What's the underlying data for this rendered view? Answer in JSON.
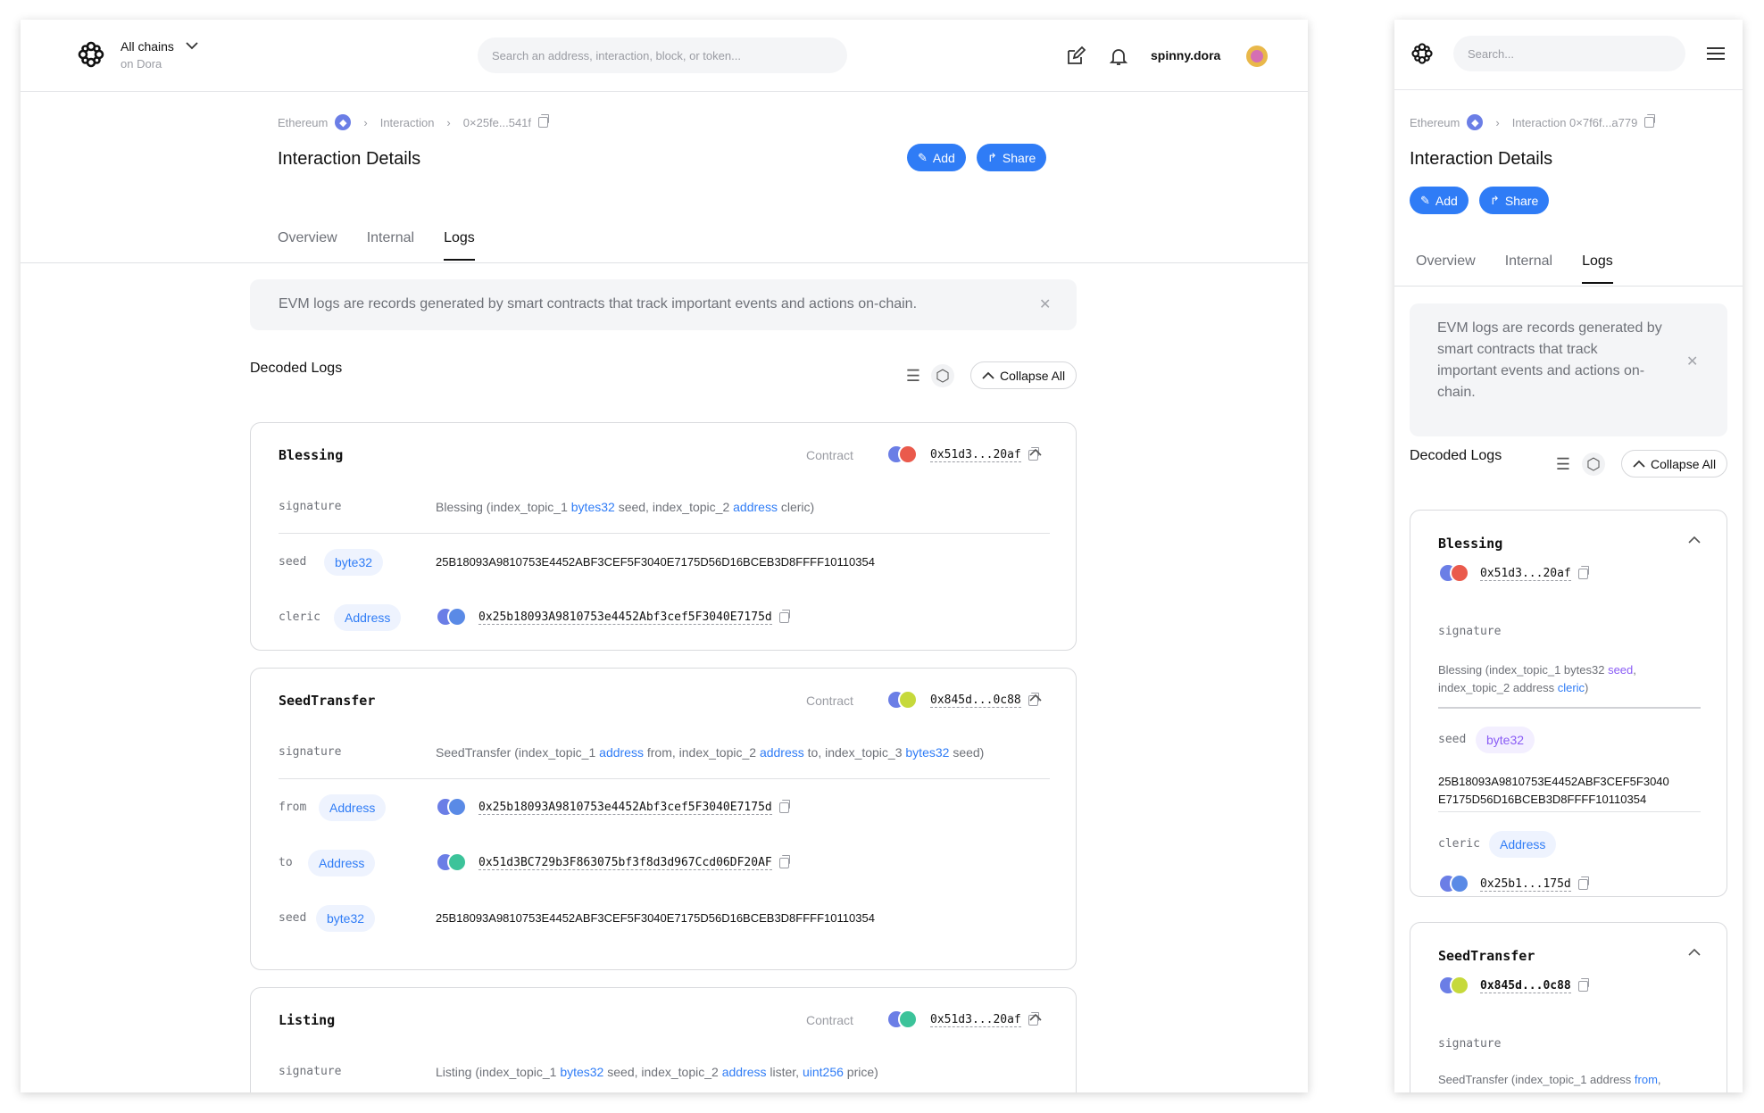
{
  "desktop": {
    "header": {
      "chain_selector": "All chains",
      "chain_sub": "on Dora",
      "search_placeholder": "Search an address, interaction, block, or token...",
      "username": "spinny.dora"
    },
    "breadcrumb": {
      "chain": "Ethereum",
      "section": "Interaction",
      "hash": "0×25fe...541f"
    },
    "title": "Interaction Details",
    "buttons": {
      "add": "Add",
      "share": "Share"
    },
    "tabs": [
      "Overview",
      "Internal",
      "Logs"
    ],
    "active_tab": "Logs",
    "info_text": "EVM logs are records generated by smart contracts that track important events and actions on-chain.",
    "decoded_title": "Decoded Logs",
    "collapse_all": "Collapse All",
    "contract_label": "Contract",
    "logs": [
      {
        "name": "Blessing",
        "contract": "0x51d3...20af",
        "signature": {
          "key": "signature",
          "parts": [
            "Blessing (index_topic_1 ",
            "bytes32",
            " seed, index_topic_2 ",
            "address",
            " cleric)"
          ]
        },
        "params": [
          {
            "key": "seed",
            "tag": "byte32",
            "value": "25B18093A9810753E4452ABF3CEF5F3040E7175D56D16BCEB3D8FFFF10110354"
          },
          {
            "key": "cleric",
            "tag": "Address",
            "value": "0x25b18093A9810753e4452Abf3cef5F3040E7175d"
          }
        ]
      },
      {
        "name": "SeedTransfer",
        "contract": "0x845d...0c88",
        "signature": {
          "key": "signature",
          "parts": [
            "SeedTransfer (index_topic_1 ",
            "address",
            " from, index_topic_2 ",
            "address",
            " to, index_topic_3 ",
            "bytes32",
            " seed)"
          ]
        },
        "params": [
          {
            "key": "from",
            "tag": "Address",
            "value": "0x25b18093A9810753e4452Abf3cef5F3040E7175d"
          },
          {
            "key": "to",
            "tag": "Address",
            "value": "0x51d3BC729b3F863075bf3f8d3d967Ccd06DF20AF"
          },
          {
            "key": "seed",
            "tag": "byte32",
            "value": "25B18093A9810753E4452ABF3CEF5F3040E7175D56D16BCEB3D8FFFF10110354"
          }
        ]
      },
      {
        "name": "Listing",
        "contract": "0x51d3...20af",
        "signature": {
          "key": "signature",
          "parts": [
            "Listing (index_topic_1 ",
            "bytes32",
            " seed, index_topic_2 ",
            "address",
            " lister, ",
            "uint256",
            " price)"
          ]
        },
        "params": []
      }
    ]
  },
  "mobile": {
    "search_placeholder": "Search...",
    "breadcrumb": {
      "chain": "Ethereum",
      "hash": "Interaction 0×7f6f...a779"
    },
    "title": "Interaction Details",
    "buttons": {
      "add": "Add",
      "share": "Share"
    },
    "tabs": [
      "Overview",
      "Internal",
      "Logs"
    ],
    "info_lines": [
      "EVM logs are records generated by",
      "smart contracts that track",
      "important events and actions on-",
      "chain."
    ],
    "decoded_title": "Decoded Logs",
    "collapse_all": "Collapse All",
    "blessing": {
      "name": "Blessing",
      "contract": "0x51d3...20af",
      "signature_key": "signature",
      "sig_line1": [
        "Blessing (index_topic_1 bytes32 ",
        "seed",
        ","
      ],
      "sig_line2": [
        "index_topic_2 address ",
        "cleric",
        ")"
      ],
      "seed_key": "seed",
      "seed_tag": "byte32",
      "seed_line1": "25B18093A9810753E4452ABF3CEF5F3040",
      "seed_line2": "E7175D56D16BCEB3D8FFFF10110354",
      "cleric_key": "cleric",
      "cleric_tag": "Address",
      "cleric_addr": "0x25b1...175d"
    },
    "seedtransfer": {
      "name": "SeedTransfer",
      "contract": "0x845d...0c88",
      "signature_key": "signature",
      "sig_line1": [
        "SeedTransfer (index_topic_1 address ",
        "from",
        ","
      ]
    }
  },
  "colors": {
    "accent": "#2f7cf6",
    "purple": "#8a5cf5",
    "muted": "#6e7178"
  },
  "icons": [
    "dora-logo-icon",
    "chevron-down-icon",
    "edit-icon",
    "bell-icon",
    "ethereum-icon",
    "copy-icon",
    "list-view-icon",
    "hexagon-icon",
    "chevron-up-icon",
    "close-icon",
    "menu-icon"
  ]
}
